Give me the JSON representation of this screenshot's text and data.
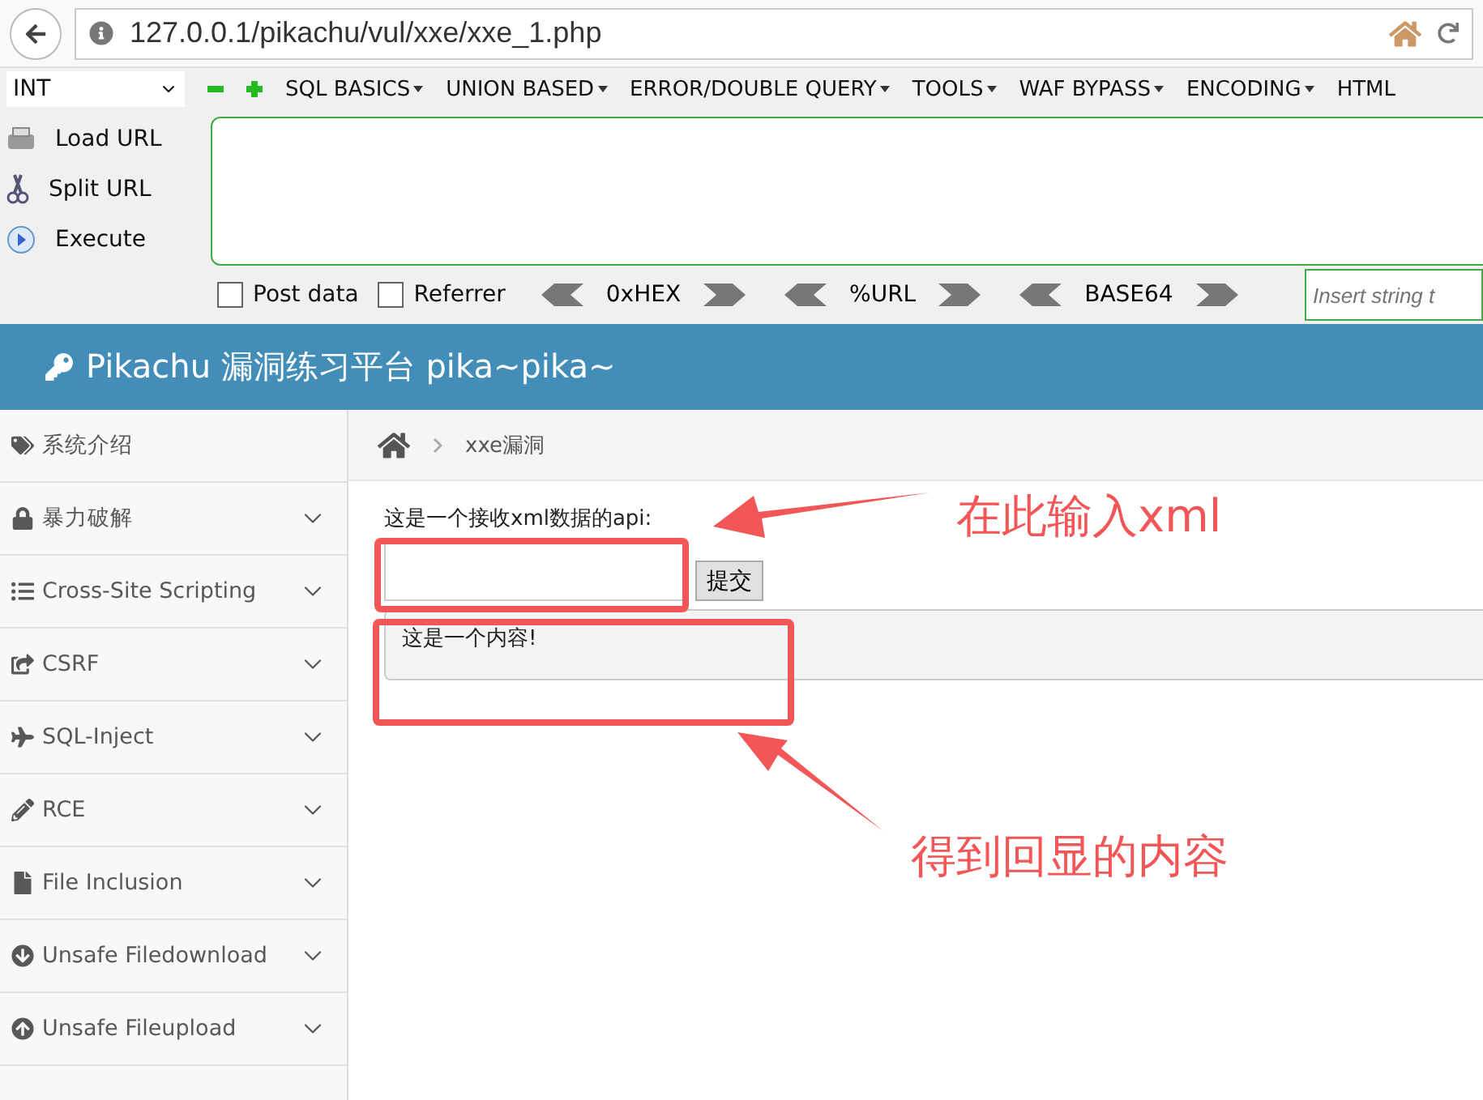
{
  "browser": {
    "url": "127.0.0.1/pikachu/vul/xxe/xxe_1.php"
  },
  "hackbar": {
    "select": "INT",
    "menus": [
      "SQL BASICS",
      "UNION BASED",
      "ERROR/DOUBLE QUERY",
      "TOOLS",
      "WAF BYPASS",
      "ENCODING",
      "HTML"
    ],
    "actions": [
      "Load URL",
      "Split URL",
      "Execute"
    ],
    "options": [
      {
        "label": "Post data",
        "checked": false
      },
      {
        "label": "Referrer",
        "checked": false
      }
    ],
    "encoders": [
      "0xHEX",
      "%URL",
      "BASE64"
    ],
    "insert": {
      "placeholder": "Insert string t"
    }
  },
  "header": {
    "title": "Pikachu 漏洞练习平台 pika~pika~"
  },
  "sidebar": {
    "items": [
      {
        "label": "系统介绍",
        "kind": "link"
      },
      {
        "label": "暴力破解",
        "kind": "menu"
      },
      {
        "label": "Cross-Site Scripting",
        "kind": "menu"
      },
      {
        "label": "CSRF",
        "kind": "menu"
      },
      {
        "label": "SQL-Inject",
        "kind": "menu"
      },
      {
        "label": "RCE",
        "kind": "menu"
      },
      {
        "label": "File Inclusion",
        "kind": "menu"
      },
      {
        "label": "Unsafe Filedownload",
        "kind": "menu"
      },
      {
        "label": "Unsafe Fileupload",
        "kind": "menu"
      }
    ]
  },
  "breadcrumb": "xxe漏洞",
  "form": {
    "label": "这是一个接收xml数据的api:",
    "submit": "提交"
  },
  "result": "这是一个内容!",
  "annotations": [
    "在此输入xml",
    "得到回显的内容"
  ]
}
